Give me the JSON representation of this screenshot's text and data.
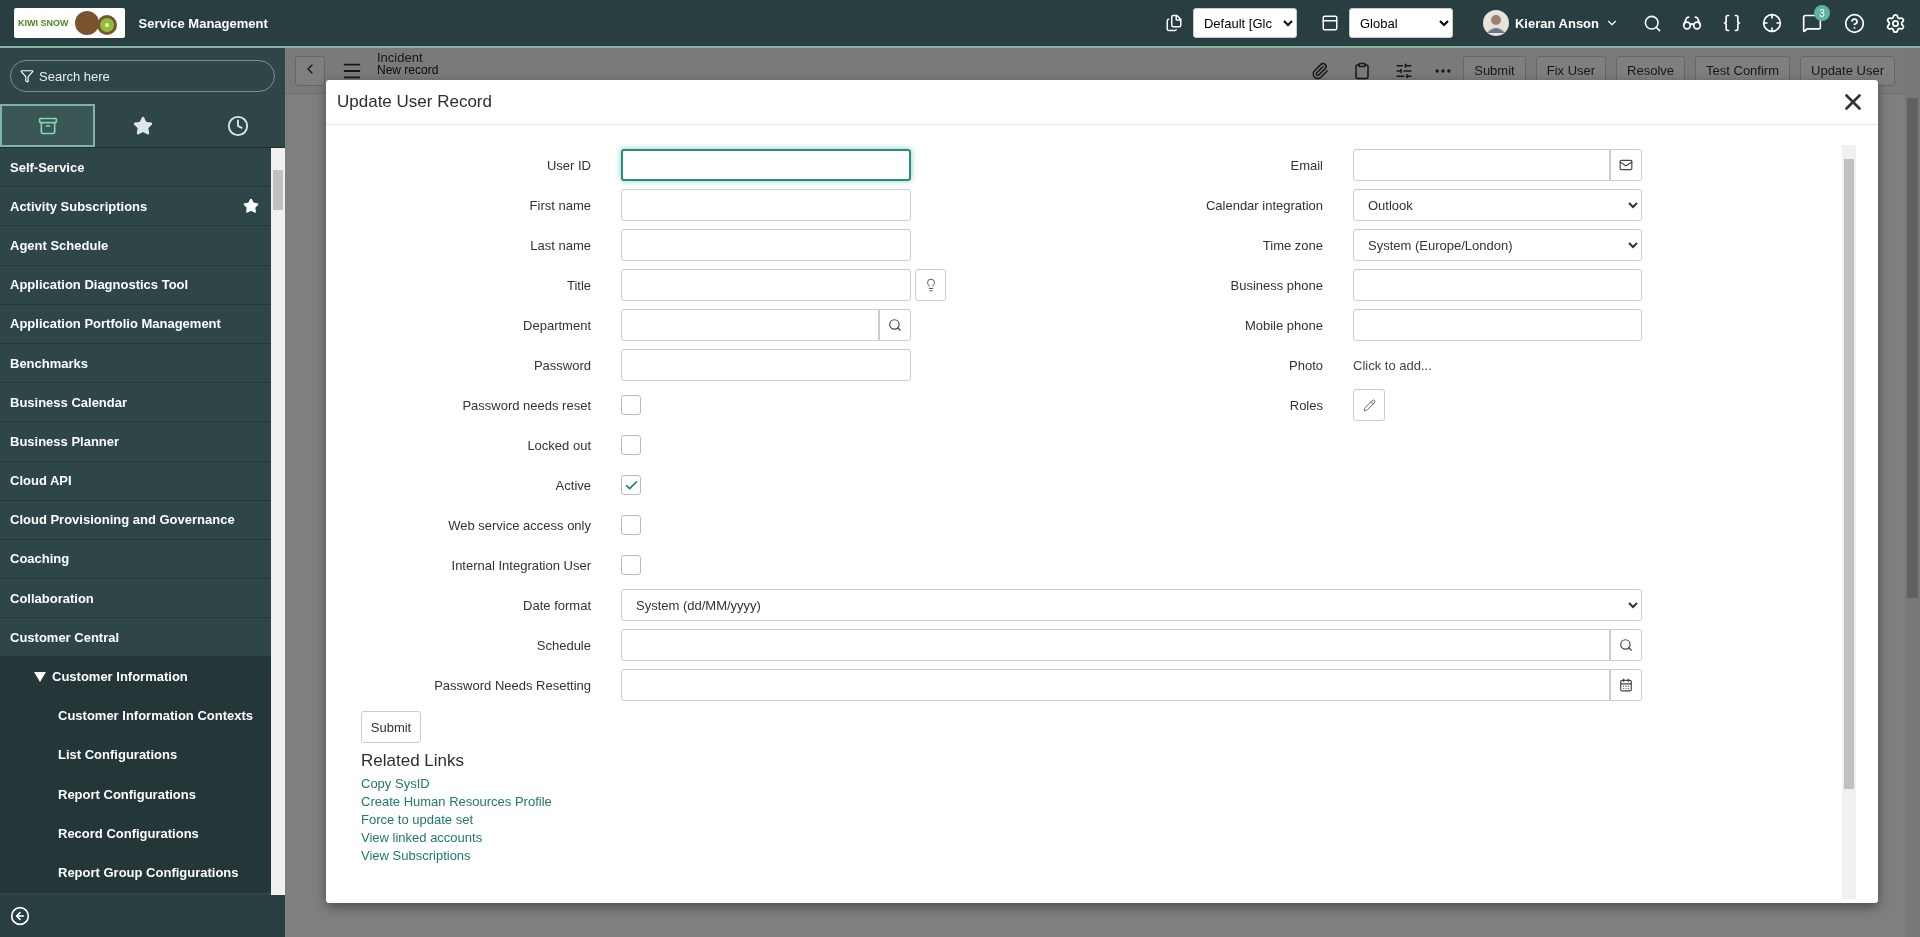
{
  "header": {
    "logo_text": "KIWI SNOW",
    "title": "Service Management",
    "update_set": "Default [Glc",
    "scope": "Global",
    "user": "Kieran Anson",
    "notification_count": "3"
  },
  "sidebar": {
    "search_placeholder": "Search here",
    "tabs": [
      {
        "kind": "all",
        "selected": true
      },
      {
        "kind": "favorites",
        "selected": false
      },
      {
        "kind": "history",
        "selected": false
      }
    ],
    "items": [
      {
        "label": "Self-Service",
        "favorite": false
      },
      {
        "label": "Activity Subscriptions",
        "favorite": true
      },
      {
        "label": "Agent Schedule",
        "favorite": false
      },
      {
        "label": "Application Diagnostics Tool",
        "favorite": false
      },
      {
        "label": "Application Portfolio Management",
        "favorite": false
      },
      {
        "label": "Benchmarks",
        "favorite": false
      },
      {
        "label": "Business Calendar",
        "favorite": false
      },
      {
        "label": "Business Planner",
        "favorite": false
      },
      {
        "label": "Cloud API",
        "favorite": false
      },
      {
        "label": "Cloud Provisioning and Governance",
        "favorite": false
      },
      {
        "label": "Coaching",
        "favorite": false
      },
      {
        "label": "Collaboration",
        "favorite": false
      },
      {
        "label": "Customer Central",
        "favorite": false,
        "children": [
          {
            "label": "Customer Information",
            "favorite": false,
            "expanded": true,
            "children": [
              {
                "label": "Customer Information Contexts",
                "favorite": false
              },
              {
                "label": "List Configurations",
                "favorite": false
              },
              {
                "label": "Report Configurations",
                "favorite": false
              },
              {
                "label": "Record Configurations",
                "favorite": false
              },
              {
                "label": "Report Group Configurations",
                "favorite": false
              }
            ]
          }
        ]
      }
    ]
  },
  "background": {
    "title": "Incident",
    "subtitle": "New record",
    "buttons": [
      "Submit",
      "Fix User",
      "Resolve",
      "Test Confirm",
      "Update User"
    ]
  },
  "modal": {
    "title": "Update User Record",
    "left_fields": [
      {
        "label": "User ID",
        "kind": "text",
        "focused": true
      },
      {
        "label": "First name",
        "kind": "text",
        "focused": false
      },
      {
        "label": "Last name",
        "kind": "text",
        "focused": false
      },
      {
        "label": "Title",
        "kind": "suggest",
        "focused": false
      },
      {
        "label": "Department",
        "kind": "lookup",
        "focused": false
      },
      {
        "label": "Password",
        "kind": "text",
        "focused": false
      },
      {
        "label": "Password needs reset",
        "kind": "checkbox",
        "checked": false
      },
      {
        "label": "Locked out",
        "kind": "checkbox",
        "checked": false
      },
      {
        "label": "Active",
        "kind": "checkbox",
        "checked": true
      },
      {
        "label": "Web service access only",
        "kind": "checkbox",
        "checked": false
      },
      {
        "label": "Internal Integration User",
        "kind": "checkbox",
        "checked": false
      }
    ],
    "right_fields": [
      {
        "label": "Email",
        "kind": "email",
        "focused": false
      },
      {
        "label": "Calendar integration",
        "kind": "select",
        "value": "Outlook"
      },
      {
        "label": "Time zone",
        "kind": "select",
        "value": "System (Europe/London)"
      },
      {
        "label": "Business phone",
        "kind": "text",
        "focused": false
      },
      {
        "label": "Mobile phone",
        "kind": "text",
        "focused": false
      },
      {
        "label": "Photo",
        "kind": "attachment",
        "value": "Click to add..."
      },
      {
        "label": "Roles",
        "kind": "edit"
      }
    ],
    "wide_fields": [
      {
        "label": "Date format",
        "kind": "select",
        "value": "System (dd/MM/yyyy)"
      },
      {
        "label": "Schedule",
        "kind": "lookup",
        "focused": false
      },
      {
        "label": "Password Needs Resetting",
        "kind": "date",
        "focused": false
      }
    ],
    "submit": "Submit",
    "related_links": {
      "title": "Related Links",
      "links": [
        "Copy SysID",
        "Create Human Resources Profile",
        "Force to update set",
        "View linked accounts",
        "View Subscriptions"
      ]
    }
  }
}
